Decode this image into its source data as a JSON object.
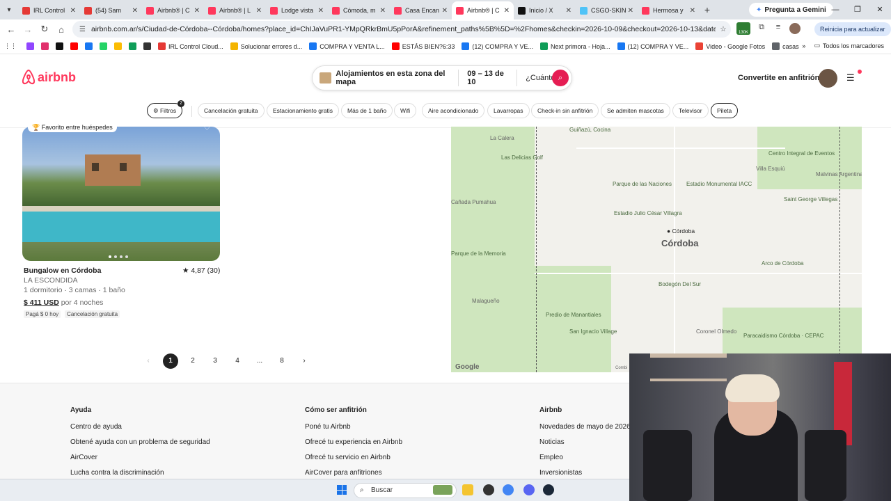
{
  "browser": {
    "tabs": [
      {
        "label": "IRL Control",
        "color": "#e53935",
        "active": false
      },
      {
        "label": "(54) Sam",
        "color": "#e53935",
        "active": false
      },
      {
        "label": "Airbnb® | C",
        "color": "#ff385c",
        "active": false
      },
      {
        "label": "Airbnb® | L",
        "color": "#ff385c",
        "active": false
      },
      {
        "label": "Lodge vista",
        "color": "#ff385c",
        "active": false
      },
      {
        "label": "Cómoda, m",
        "color": "#ff385c",
        "active": false
      },
      {
        "label": "Casa Encan",
        "color": "#ff385c",
        "active": false
      },
      {
        "label": "Airbnb® | C",
        "color": "#ff385c",
        "active": true
      },
      {
        "label": "Inicio / X",
        "color": "#111111",
        "active": false
      },
      {
        "label": "CSGO-SKIN",
        "color": "#4fc3f7",
        "active": false
      },
      {
        "label": "Hermosa y",
        "color": "#ff385c",
        "active": false
      }
    ],
    "gemini_label": "Pregunta a Gemini",
    "url": "airbnb.com.ar/s/Ciudad-de-Córdoba--Córdoba/homes?place_id=ChIJaVuPR1-YMpQRkrBmU5pPorA&refinement_paths%5B%5D=%2Fhomes&checkin=2026-10-09&checkout=2026-10-13&date_picker_type=calenda...",
    "ext_badge": "130K",
    "update_label": "Reinicia para actualizar",
    "bookmarks": [
      {
        "label": "",
        "color": "#9146ff"
      },
      {
        "label": "",
        "color": "#e1306c"
      },
      {
        "label": "",
        "color": "#111111"
      },
      {
        "label": "",
        "color": "#ff0000"
      },
      {
        "label": "",
        "color": "#1877f2"
      },
      {
        "label": "",
        "color": "#25d366"
      },
      {
        "label": "",
        "color": "#fbbc04"
      },
      {
        "label": "",
        "color": "#0f9d58"
      },
      {
        "label": "",
        "color": "#333333"
      },
      {
        "label": "IRL Control Cloud...",
        "color": "#e53935"
      },
      {
        "label": "Solucionar errores d...",
        "color": "#f4b400"
      },
      {
        "label": "COMPRA Y VENTA L...",
        "color": "#1877f2"
      },
      {
        "label": "ESTÁS BIEN?6:33",
        "color": "#ff0000"
      },
      {
        "label": "(12) COMPRA Y VE...",
        "color": "#1877f2"
      },
      {
        "label": "Next primora - Hoja...",
        "color": "#0f9d58"
      },
      {
        "label": "(12) COMPRA Y VE...",
        "color": "#1877f2"
      },
      {
        "label": "Video - Google Fotos",
        "color": "#ea4335"
      },
      {
        "label": "casas",
        "color": "#5f6368"
      }
    ],
    "bookmarks_all": "Todos los marcadores"
  },
  "header": {
    "logo_text": "airbnb",
    "search_place": "Alojamientos en esta zona del mapa",
    "search_dates": "09 – 13 de 10",
    "search_guests": "¿Cuántos?",
    "host_link": "Convertite en anfitrión",
    "accent": "#ff385c"
  },
  "filters": {
    "filtros_label": "Filtros",
    "filtros_count": "2",
    "chips": [
      "Cancelación gratuita",
      "Estacionamiento gratis",
      "Más de 1 baño",
      "Wifi",
      "Aire acondicionado",
      "Lavarropas",
      "Check-in sin anfitrión",
      "Se admiten mascotas",
      "Televisor",
      "Pileta"
    ]
  },
  "listing": {
    "badge": "Favorito entre huéspedes",
    "title": "Bungalow en Córdoba",
    "rating": "★ 4,87 (30)",
    "subtitle": "LA ESCONDIDA",
    "beds": "1 dormitorio · 3 camas · 1 baño",
    "price": "$ 411 USD",
    "price_suffix": " por 4 noches",
    "tags": [
      "Pagá $ 0 hoy",
      "Cancelación gratuita"
    ]
  },
  "pagination": {
    "prev": "‹",
    "pages": [
      "1",
      "2",
      "3",
      "4",
      "...",
      "8"
    ],
    "current": "1",
    "next": "›"
  },
  "map": {
    "labels": [
      {
        "text": "La Calera",
        "cls": "grey"
      },
      {
        "text": "Guiñazú, Cocina",
        "cls": ""
      },
      {
        "text": "Las Delicias Golf",
        "cls": ""
      },
      {
        "text": "Parque de las Naciones",
        "cls": ""
      },
      {
        "text": "Estadio Monumental IACC",
        "cls": ""
      },
      {
        "text": "Centro Integral de Eventos",
        "cls": ""
      },
      {
        "text": "Villa Esquiú",
        "cls": "grey"
      },
      {
        "text": "Malvinas Argentinas",
        "cls": "grey"
      },
      {
        "text": "Saint George Villegas",
        "cls": ""
      },
      {
        "text": "Estadio Julio César Villagra",
        "cls": ""
      },
      {
        "text": "Cañada Pumahua",
        "cls": "grey"
      },
      {
        "text": "Parque de la Memoria",
        "cls": ""
      },
      {
        "text": "Arco de Córdoba",
        "cls": ""
      },
      {
        "text": "Bodegón Del Sur",
        "cls": ""
      },
      {
        "text": "Malagueño",
        "cls": "grey"
      },
      {
        "text": "Predio de Manantiales",
        "cls": ""
      },
      {
        "text": "San Ignacio Village",
        "cls": ""
      },
      {
        "text": "Coronel Olmedo",
        "cls": "grey"
      },
      {
        "text": "Paracaidismo Córdoba · CEPAC",
        "cls": ""
      }
    ],
    "pin_label": "Córdoba",
    "city_label": "Córdoba",
    "google": "Google",
    "combi": "Combi"
  },
  "footer": {
    "columns": [
      {
        "title": "Ayuda",
        "links": [
          "Centro de ayuda",
          "Obtené ayuda con un problema de seguridad",
          "AirCover",
          "Lucha contra la discriminación"
        ]
      },
      {
        "title": "Cómo ser anfitrión",
        "links": [
          "Poné tu Airbnb",
          "Ofrecé tu experiencia en Airbnb",
          "Ofrecé tu servicio en Airbnb",
          "AirCover para anfitriones"
        ]
      },
      {
        "title": "Airbnb",
        "links": [
          "Novedades de mayo de 2026",
          "Noticias",
          "Empleo",
          "Inversionistas"
        ]
      }
    ]
  },
  "taskbar": {
    "search_placeholder": "Buscar"
  }
}
